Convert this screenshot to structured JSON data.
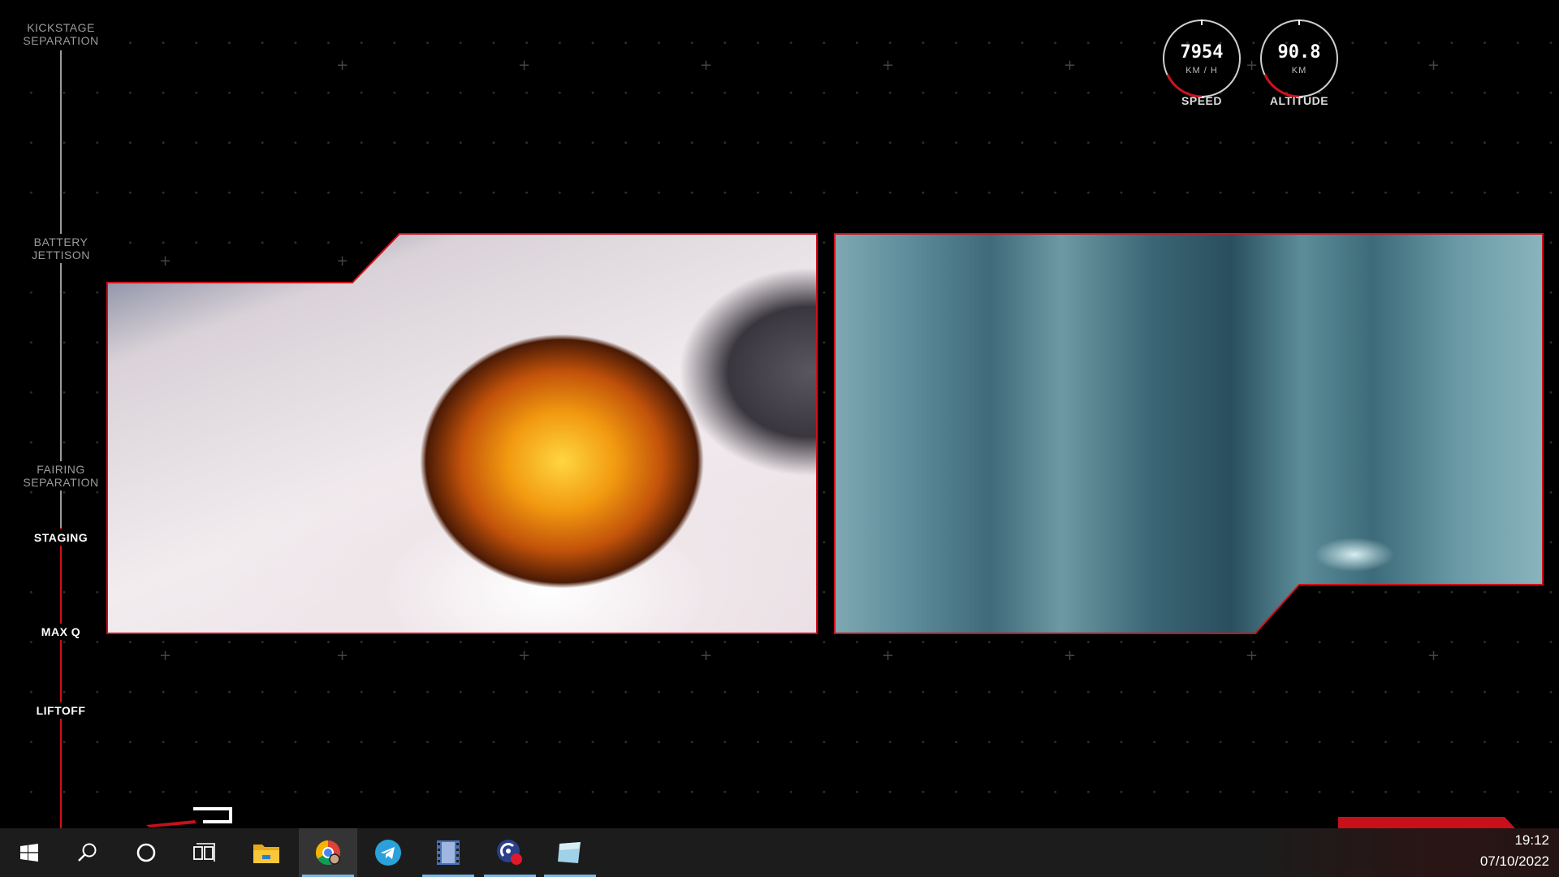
{
  "timeline": {
    "events": [
      {
        "label": "KICKSTAGE\nSEPARATION",
        "active": false
      },
      {
        "label": "BATTERY\nJETTISON",
        "active": false
      },
      {
        "label": "FAIRING\nSEPARATION",
        "active": false
      },
      {
        "label": "STAGING",
        "active": true
      },
      {
        "label": "MAX Q",
        "active": true
      },
      {
        "label": "LIFTOFF",
        "active": true
      }
    ]
  },
  "telemetry": {
    "speed": {
      "value": "7954",
      "unit": "KM / H",
      "label": "SPEED"
    },
    "altitude": {
      "value": "90.8",
      "unit": "KM",
      "label": "ALTITUDE"
    }
  },
  "colors": {
    "accent_red": "#d0101c",
    "inactive_grey": "#9a9a9a",
    "taskbar": "#1c1c1c"
  },
  "taskbar": {
    "items": [
      {
        "icon": "windows-start-icon",
        "active": false
      },
      {
        "icon": "search-icon",
        "active": false
      },
      {
        "icon": "cortana-icon",
        "active": false
      },
      {
        "icon": "task-view-icon",
        "active": false
      },
      {
        "icon": "file-explorer-icon",
        "active": false
      },
      {
        "icon": "chrome-icon",
        "active": true
      },
      {
        "icon": "telegram-icon",
        "active": false
      },
      {
        "icon": "video-player-icon",
        "active": true
      },
      {
        "icon": "app-notification-icon",
        "active": true
      },
      {
        "icon": "sticky-app-icon",
        "active": true
      }
    ],
    "clock": {
      "time": "19:12",
      "date": "07/10/2022"
    }
  }
}
